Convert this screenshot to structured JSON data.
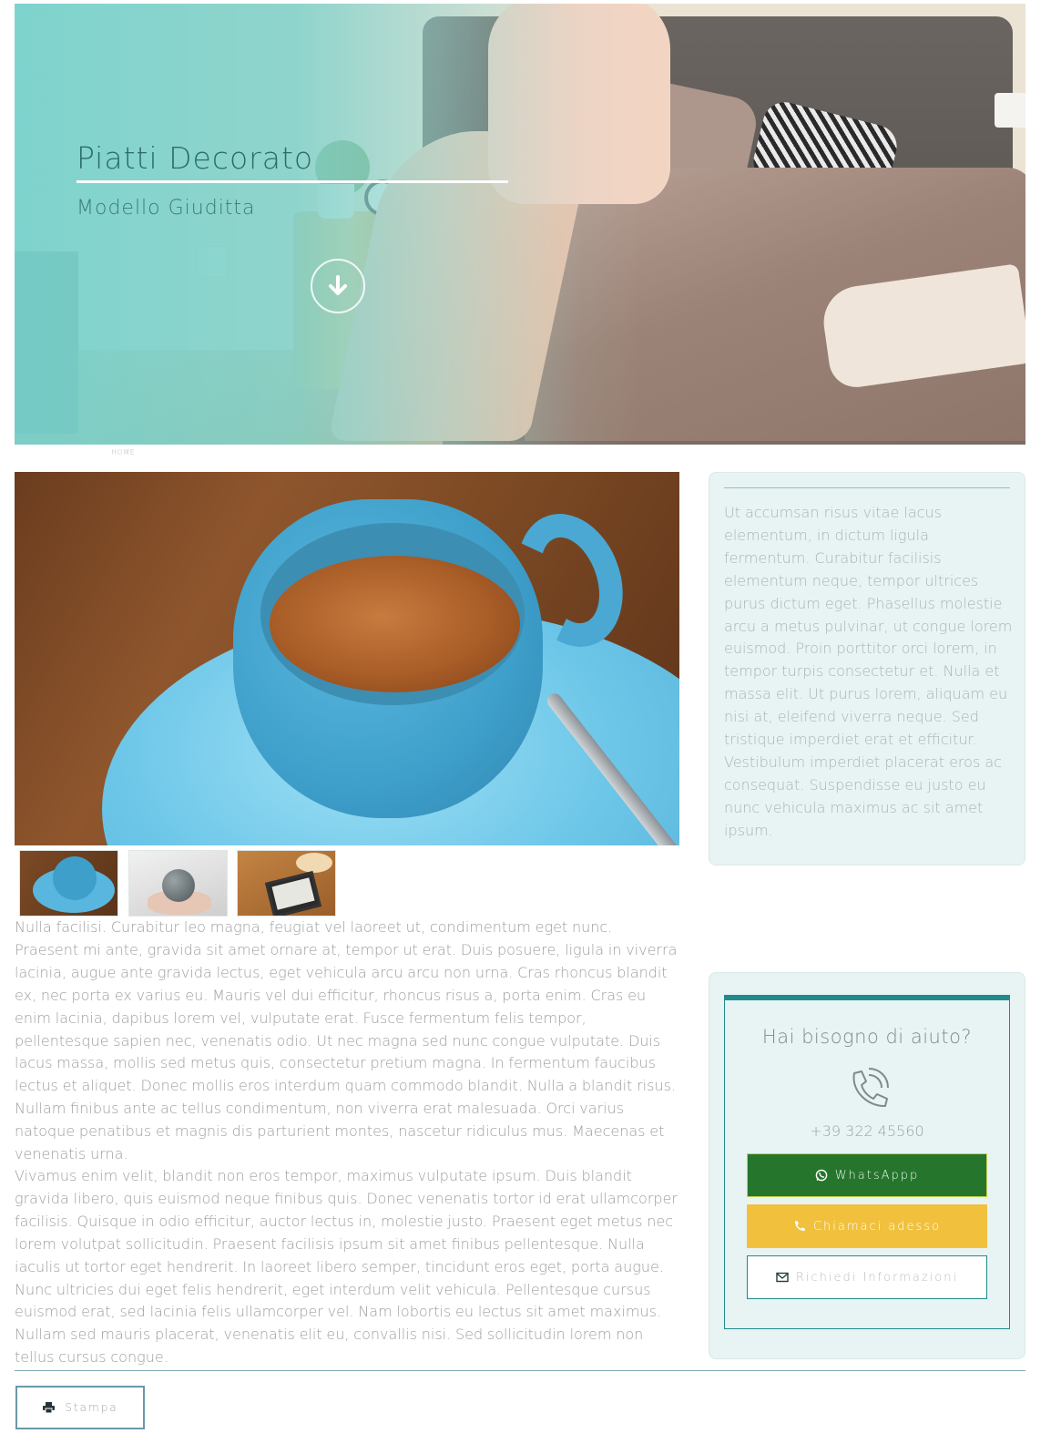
{
  "hero": {
    "title": "Piatti Decorato",
    "subtitle": "Modello Giuditta",
    "scroll_icon": "arrow-down-circle-icon",
    "overlay_color": "#7fd3cd"
  },
  "breadcrumb": {
    "home": "HOME"
  },
  "gallery": {
    "thumbnails": [
      "coffee-cup",
      "hands-with-ball",
      "tablet-with-donuts"
    ]
  },
  "content": {
    "paragraph1": "Nulla facilisi. Curabitur leo magna, feugiat vel laoreet ut, condimentum eget nunc. Praesent mi ante, gravida sit amet ornare at, tempor ut erat. Duis posuere, ligula in viverra lacinia, augue ante gravida lectus, eget vehicula arcu arcu non urna. Cras rhoncus blandit ex, nec porta ex varius eu. Mauris vel dui efficitur, rhoncus risus a, porta enim. Cras eu enim lacinia, dapibus lorem vel, vulputate erat. Fusce fermentum felis tempor, pellentesque sapien nec, venenatis odio. Ut nec magna sed nunc congue vulputate. Duis lacus massa, mollis sed metus quis, consectetur pretium magna. In fermentum faucibus lectus et aliquet. Donec mollis eros interdum quam commodo blandit. Nulla a blandit risus. Nullam finibus ante ac tellus condimentum, non viverra erat malesuada. Orci varius natoque penatibus et magnis dis parturient montes, nascetur ridiculus mus. Maecenas et venenatis urna.",
    "paragraph2": "Vivamus enim velit, blandit non eros tempor, maximus vulputate ipsum. Duis blandit gravida libero, quis euismod neque finibus quis. Donec venenatis tortor id erat ullamcorper facilisis. Quisque in odio efficitur, auctor lectus in, molestie justo. Praesent eget metus nec lorem volutpat sollicitudin. Praesent facilisis ipsum sit amet finibus pellentesque. Nulla iaculis ut tortor eget hendrerit. In laoreet libero semper, tincidunt eros eget, porta augue. Nunc ultricies dui eget felis hendrerit, eget interdum velit vehicula. Pellentesque cursus euismod erat, sed lacinia felis ullamcorper vel. Nam lobortis eu lectus sit amet maximus. Nullam sed mauris placerat, venenatis elit eu, convallis nisi. Sed sollicitudin lorem non tellus cursus congue."
  },
  "sidebar": {
    "description": "Ut accumsan risus vitae lacus elementum, in dictum ligula fermentum. Curabitur facilisis elementum neque, tempor ultrices purus dictum eget. Phasellus molestie arcu a metus pulvinar, ut congue lorem euismod. Proin porttitor orci lorem, in tempor turpis consectetur et. Nulla et massa elit. Ut purus lorem, aliquam eu nisi at, eleifend viverra neque. Sed tristique imperdiet erat et efficitur. Vestibulum imperdiet placerat eros ac consequat. Suspendisse eu justo eu nunc vehicula maximus ac sit amet ipsum.",
    "help": {
      "title": "Hai bisogno di aiuto?",
      "phone_icon": "phone-icon",
      "phone": "+39 322 45560",
      "whatsapp_label": "WhatsAppp",
      "call_label": "Chiamaci adesso",
      "info_label": "Richiedi Informazioni",
      "colors": {
        "whatsapp": "#25752d",
        "call": "#f1c13e",
        "frame": "#1f8b8d"
      }
    }
  },
  "footer": {
    "print_label": "Stampa",
    "print_icon": "printer-icon"
  }
}
